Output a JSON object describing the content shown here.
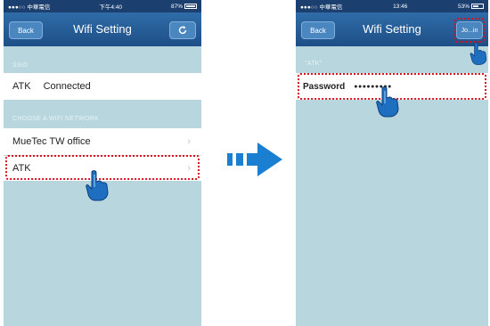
{
  "colors": {
    "navbar": "#1e4f86",
    "background": "#b7d6de",
    "highlight": "#d6121f",
    "arrow": "#1a7fd1"
  },
  "left_phone": {
    "status": {
      "carrier": "●●●○○ 中華電信",
      "time": "下午4:40",
      "battery": "87%"
    },
    "nav": {
      "back_label": "Back",
      "title": "Wifi Setting",
      "refresh_icon": "refresh-icon"
    },
    "ssid_header": "SSID",
    "current_network": {
      "name": "ATK",
      "status": "Connected"
    },
    "choose_header": "CHOOSE A WIFI NETWORK",
    "networks": [
      {
        "name": "MueTec  TW office"
      },
      {
        "name": "ATK"
      }
    ]
  },
  "right_phone": {
    "status": {
      "carrier": "●●●○○ 中華電信",
      "time": "13:46",
      "battery": "53%"
    },
    "nav": {
      "back_label": "Back",
      "title": "Wifi Setting",
      "join_label": "Jo...in"
    },
    "network_header": "\"ATK\"",
    "password": {
      "label": "Password",
      "value": "●●●●●●●●●"
    }
  },
  "arrow": {
    "icon": "right-arrow-icon"
  }
}
